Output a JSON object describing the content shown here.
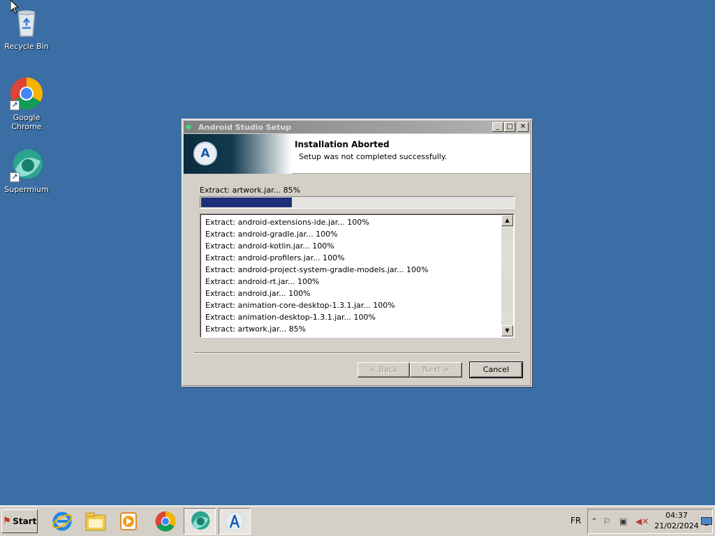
{
  "desktop": {
    "icons": [
      {
        "label": "Recycle Bin",
        "icon": "recycle-bin-icon"
      },
      {
        "label": "Google Chrome",
        "icon": "chrome-icon"
      },
      {
        "label": "Supermium",
        "icon": "supermium-icon"
      }
    ]
  },
  "window": {
    "title": "Android Studio Setup",
    "header_title": "Installation Aborted",
    "header_subtitle": "Setup was not completed successfully.",
    "current_status": "Extract: artwork.jar... 85%",
    "progress_percent": 29,
    "log": [
      "Extract: android-extensions-ide.jar... 100%",
      "Extract: android-gradle.jar... 100%",
      "Extract: android-kotlin.jar... 100%",
      "Extract: android-profilers.jar... 100%",
      "Extract: android-project-system-gradle-models.jar... 100%",
      "Extract: android-rt.jar... 100%",
      "Extract: android.jar... 100%",
      "Extract: animation-core-desktop-1.3.1.jar... 100%",
      "Extract: animation-desktop-1.3.1.jar... 100%",
      "Extract: artwork.jar... 85%"
    ],
    "buttons": {
      "back": "< Back",
      "next": "Next >",
      "cancel": "Cancel"
    }
  },
  "taskbar": {
    "start_label": "Start",
    "apps": [
      "internet-explorer-icon",
      "file-explorer-icon",
      "media-player-icon",
      "chrome-icon",
      "supermium-icon",
      "android-studio-setup-icon"
    ],
    "language": "FR",
    "time": "04:37",
    "date": "21/02/2024"
  },
  "colors": {
    "desktop": "#3a6ea5",
    "progress": "#1c2f78",
    "window_face": "#d4d0c8"
  }
}
